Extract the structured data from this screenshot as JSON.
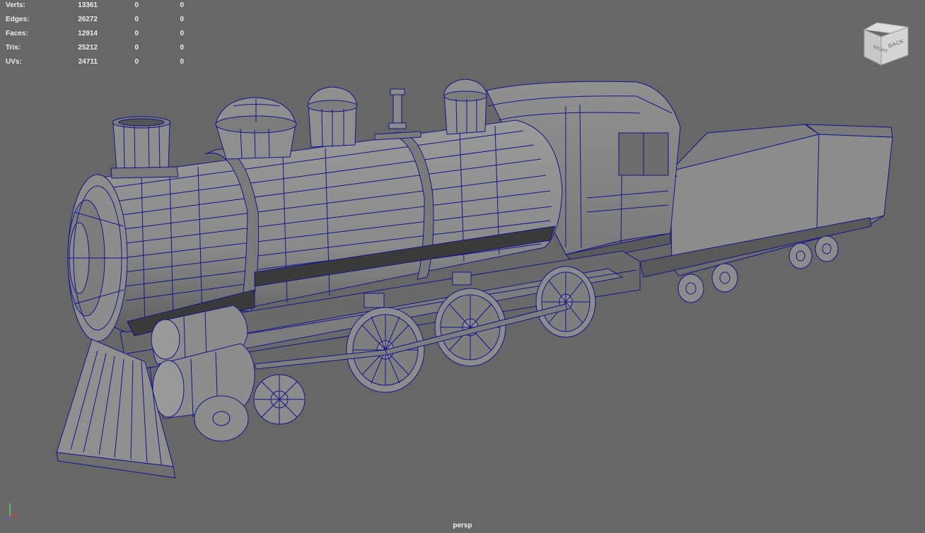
{
  "heads_up_display": {
    "rows": [
      {
        "label": "Verts:",
        "values": [
          "13361",
          "0",
          "0"
        ]
      },
      {
        "label": "Edges:",
        "values": [
          "26272",
          "0",
          "0"
        ]
      },
      {
        "label": "Faces:",
        "values": [
          "12914",
          "0",
          "0"
        ]
      },
      {
        "label": "Tris:",
        "values": [
          "25212",
          "0",
          "0"
        ]
      },
      {
        "label": "UVs:",
        "values": [
          "24711",
          "0",
          "0"
        ]
      }
    ]
  },
  "viewcube": {
    "face_right": "RIGHT",
    "face_back": "BACK"
  },
  "camera_label": "persp",
  "axis_gizmo": {
    "icon": "xyz-axis-icon"
  },
  "colors": {
    "background": "#676767",
    "wireframe": "#14148c",
    "mesh_fill": "#8a8a8a"
  }
}
